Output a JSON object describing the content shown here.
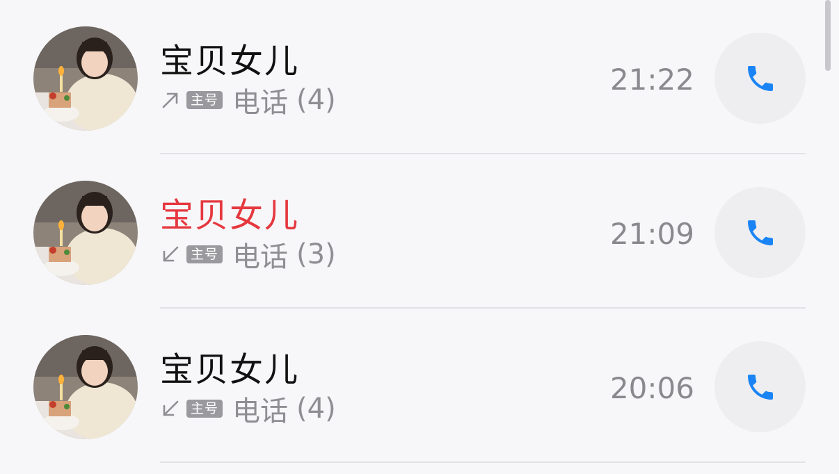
{
  "call_log": [
    {
      "contact_name": "宝贝女儿",
      "missed": false,
      "direction_icon": "outgoing-arrow-icon",
      "line_badge": "主号",
      "call_type": "电话",
      "count": "(4)",
      "time": "21:22"
    },
    {
      "contact_name": "宝贝女儿",
      "missed": true,
      "direction_icon": "incoming-arrow-icon",
      "line_badge": "主号",
      "call_type": "电话",
      "count": "(3)",
      "time": "21:09"
    },
    {
      "contact_name": "宝贝女儿",
      "missed": false,
      "direction_icon": "incoming-arrow-icon",
      "line_badge": "主号",
      "call_type": "电话",
      "count": "(4)",
      "time": "20:06"
    }
  ],
  "colors": {
    "missed_name": "#e5383f",
    "normal_name": "#111111",
    "phone_icon": "#1a84f5",
    "secondary_text": "#8e8e93"
  }
}
